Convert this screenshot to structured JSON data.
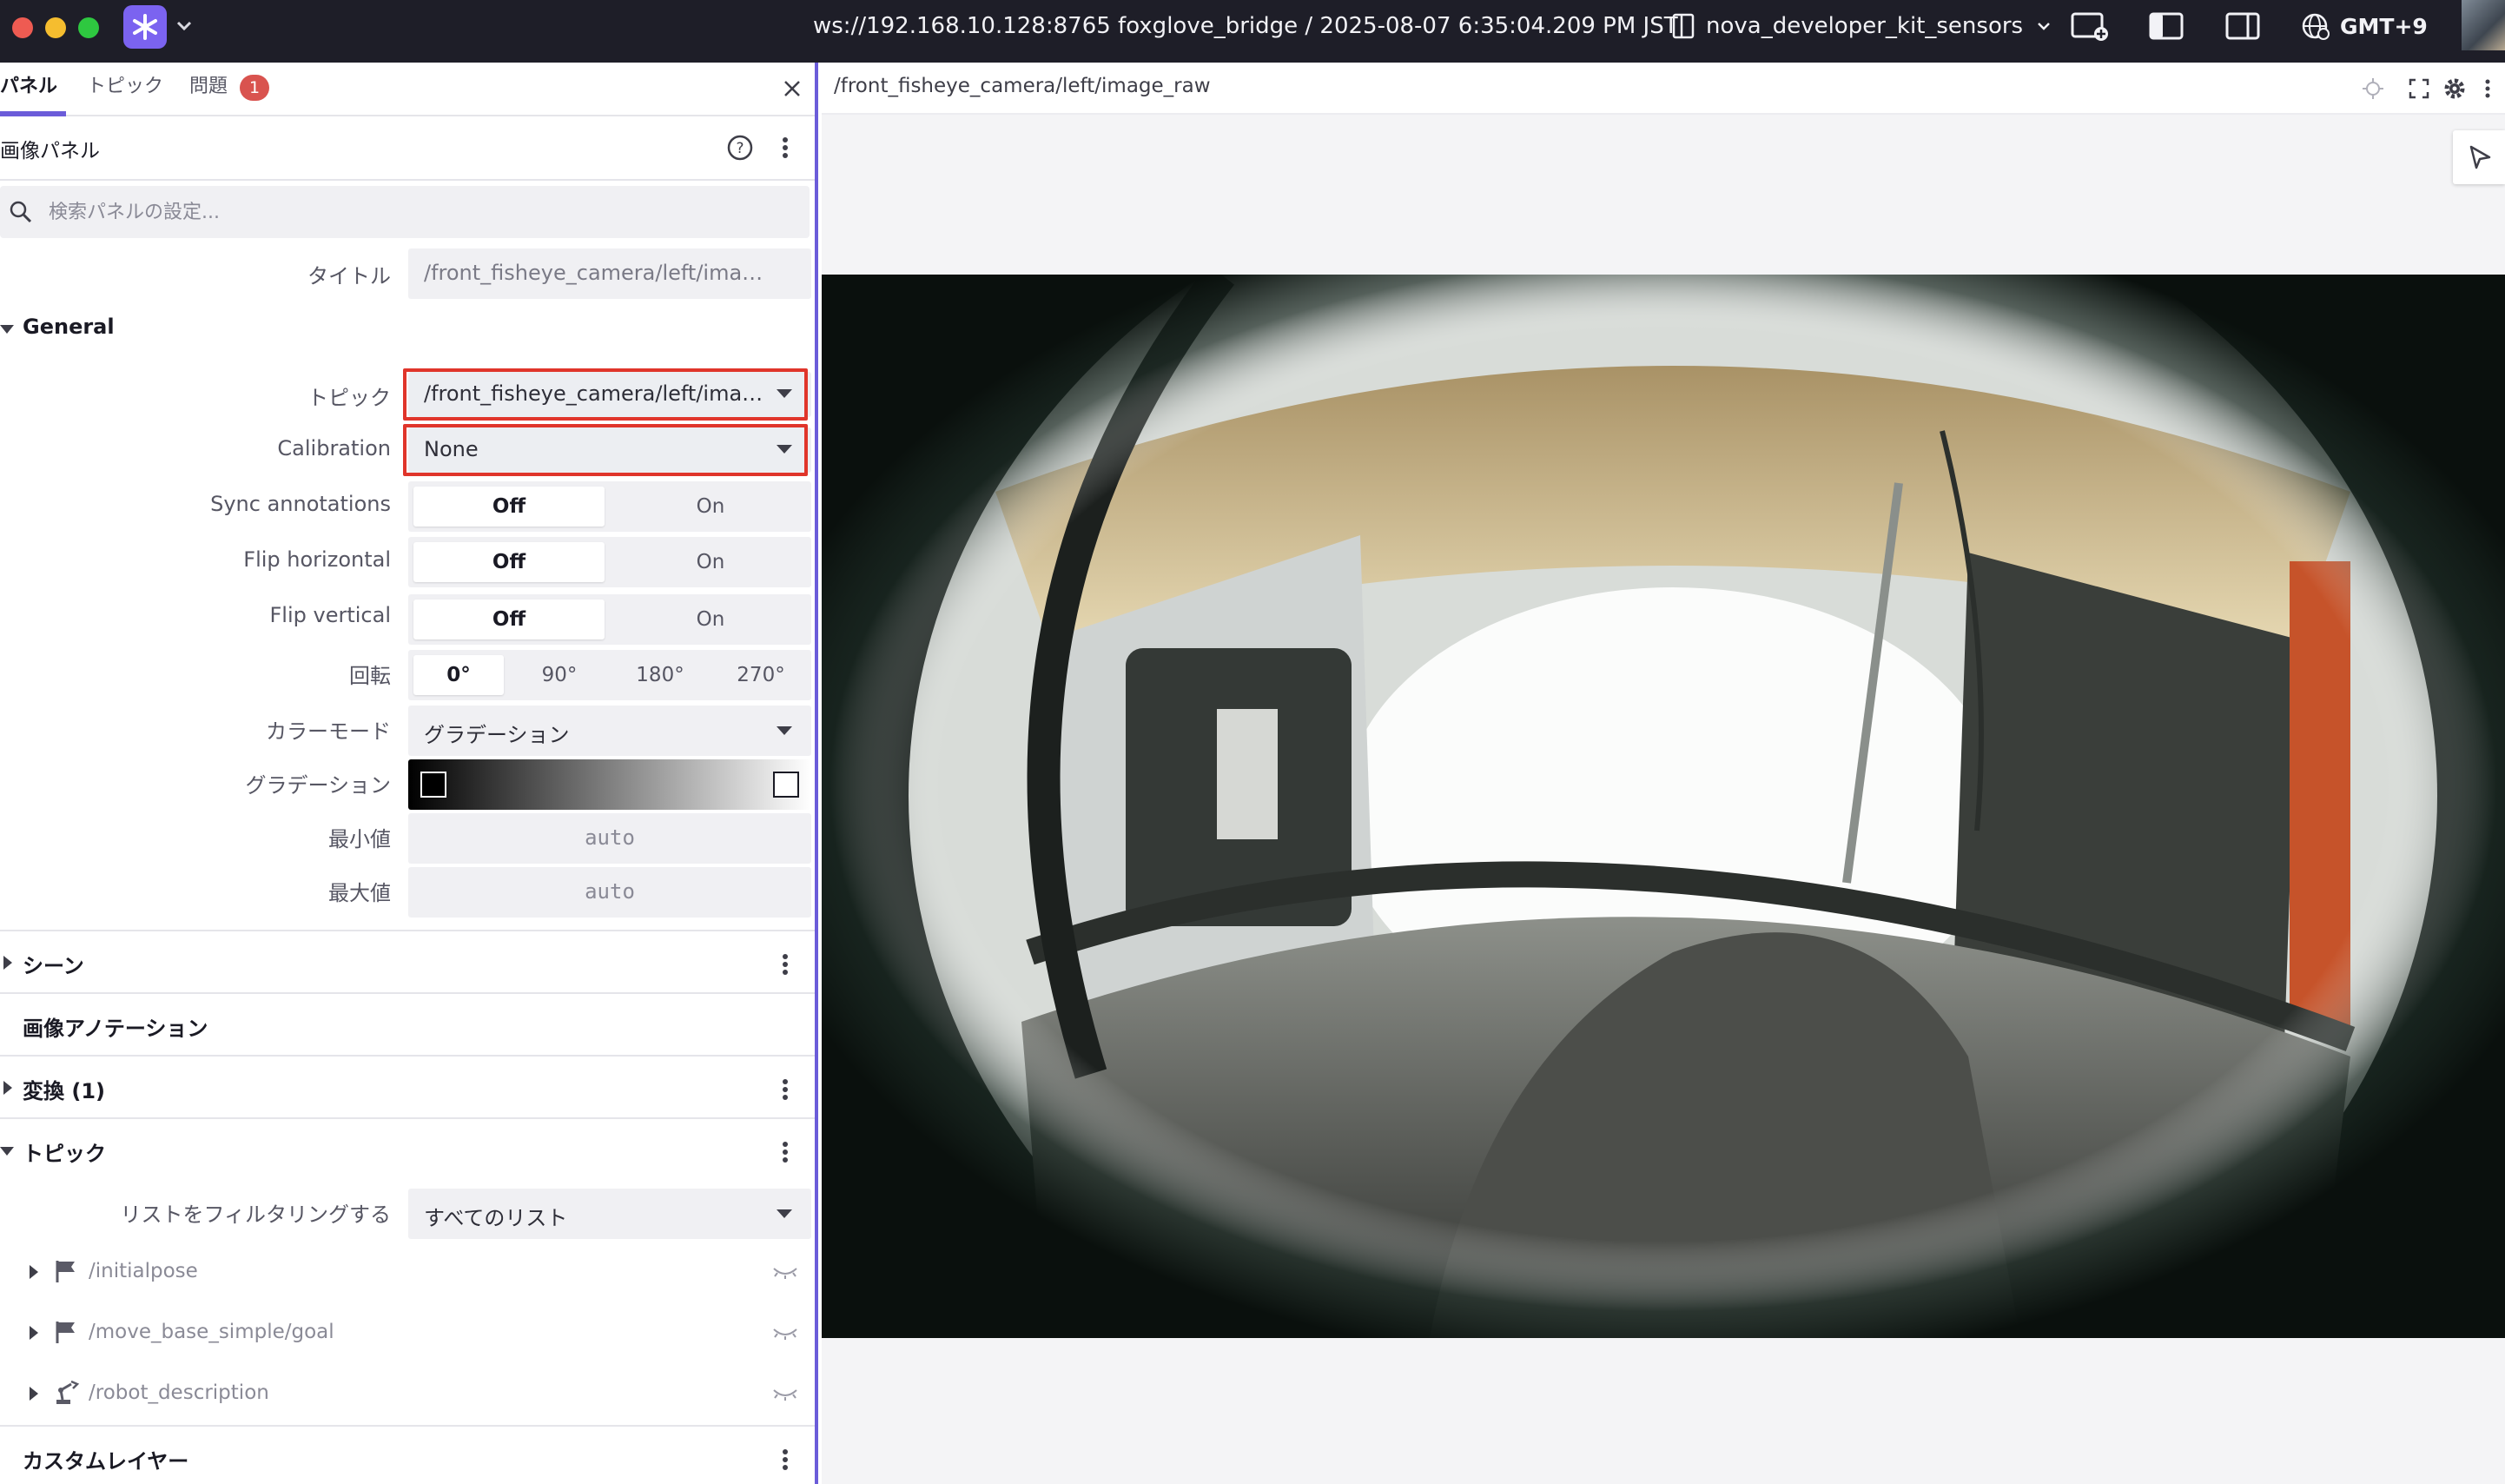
{
  "titlebar": {
    "connection": "ws://192.168.10.128:8765 foxglove_bridge / 2025-08-07 6:35:04.209 PM JST",
    "layout_name": "nova_developer_kit_sensors",
    "timezone": "GMT+9"
  },
  "sidebar": {
    "tabs": [
      {
        "label": "パネル"
      },
      {
        "label": "トピック"
      },
      {
        "label": "問題"
      }
    ],
    "problems_count": "1",
    "panel_title": "画像パネル",
    "search_placeholder": "検索パネルの設定...",
    "title_row": {
      "label": "タイトル",
      "value": "/front_fisheye_camera/left/image_raw"
    },
    "general": {
      "header": "General",
      "topic": {
        "label": "トピック",
        "value": "/front_fisheye_camera/left/imag..."
      },
      "calibration": {
        "label": "Calibration",
        "value": "None"
      },
      "sync_annotations": {
        "label": "Sync annotations",
        "off": "Off",
        "on": "On"
      },
      "flip_horizontal": {
        "label": "Flip horizontal",
        "off": "Off",
        "on": "On"
      },
      "flip_vertical": {
        "label": "Flip vertical",
        "off": "Off",
        "on": "On"
      },
      "rotation": {
        "label": "回転",
        "options": [
          "0°",
          "90°",
          "180°",
          "270°"
        ],
        "selected": "0°"
      },
      "color_mode": {
        "label": "カラーモード",
        "value": "グラデーション"
      },
      "gradient": {
        "label": "グラデーション",
        "start_color": "#000000",
        "end_color": "#ffffff"
      },
      "min": {
        "label": "最小値",
        "placeholder": "auto"
      },
      "max": {
        "label": "最大値",
        "placeholder": "auto"
      }
    },
    "sections": {
      "scene": "シーン",
      "image_annotations": "画像アノテーション",
      "transforms": "変換 (1)",
      "topics": "トピック",
      "custom_layers": "カスタムレイヤー"
    },
    "topics": {
      "filter": {
        "label": "リストをフィルタリングする",
        "value": "すべてのリスト"
      },
      "items": [
        {
          "name": "/initialpose",
          "icon": "flag-icon"
        },
        {
          "name": "/move_base_simple/goal",
          "icon": "flag-icon"
        },
        {
          "name": "/robot_description",
          "icon": "robot-arm-icon"
        }
      ]
    }
  },
  "viewer": {
    "title": "/front_fisheye_camera/left/image_raw"
  },
  "colors": {
    "accent": "#6b5cd9",
    "highlight": "#e0352b",
    "badge": "#d9534f"
  }
}
